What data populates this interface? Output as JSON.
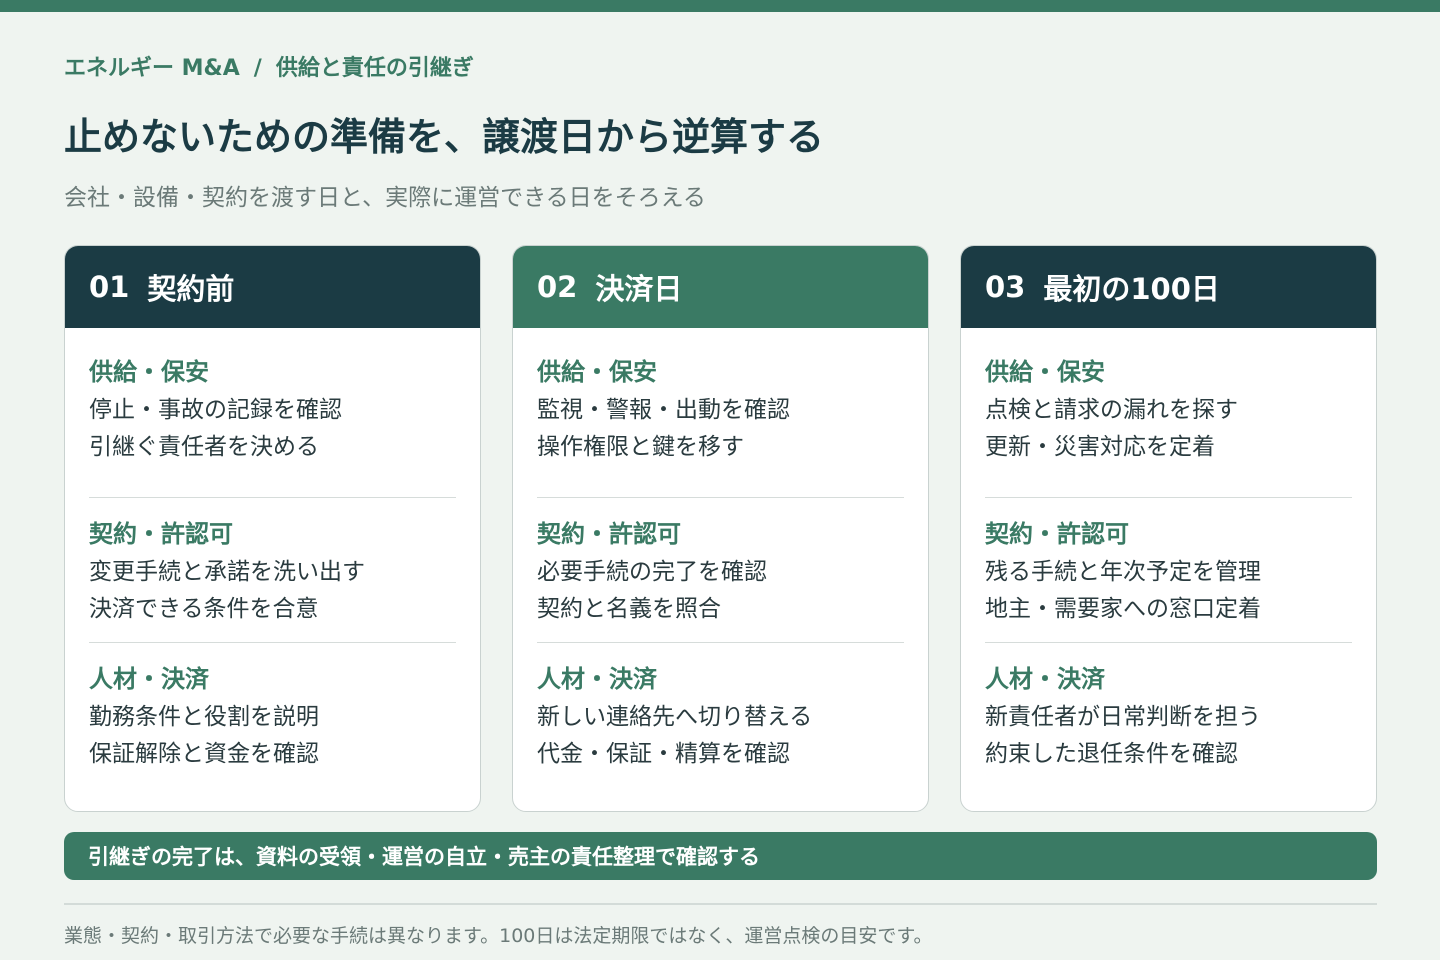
{
  "breadcrumb": {
    "category": "エネルギー M&A",
    "separator": "/",
    "topic": "供給と責任の引継ぎ"
  },
  "title": "止めないための準備を、譲渡日から逆算する",
  "subtitle": "会社・設備・契約を渡す日と、実際に運営できる日をそろえる",
  "colors": {
    "dark": "#1b3b44",
    "green": "#3a7a64",
    "background": "#eff4f0"
  },
  "cards": [
    {
      "number": "01",
      "label": "契約前",
      "sections": [
        {
          "title": "供給・保安",
          "items": [
            "停止・事故の記録を確認",
            "引継ぐ責任者を決める"
          ]
        },
        {
          "title": "契約・許認可",
          "items": [
            "変更手続と承諾を洗い出す",
            "決済できる条件を合意"
          ]
        },
        {
          "title": "人材・決済",
          "items": [
            "勤務条件と役割を説明",
            "保証解除と資金を確認"
          ]
        }
      ]
    },
    {
      "number": "02",
      "label": "決済日",
      "sections": [
        {
          "title": "供給・保安",
          "items": [
            "監視・警報・出動を確認",
            "操作権限と鍵を移す"
          ]
        },
        {
          "title": "契約・許認可",
          "items": [
            "必要手続の完了を確認",
            "契約と名義を照合"
          ]
        },
        {
          "title": "人材・決済",
          "items": [
            "新しい連絡先へ切り替える",
            "代金・保証・精算を確認"
          ]
        }
      ]
    },
    {
      "number": "03",
      "label": "最初の100日",
      "sections": [
        {
          "title": "供給・保安",
          "items": [
            "点検と請求の漏れを探す",
            "更新・災害対応を定着"
          ]
        },
        {
          "title": "契約・許認可",
          "items": [
            "残る手続と年次予定を管理",
            "地主・需要家への窓口定着"
          ]
        },
        {
          "title": "人材・決済",
          "items": [
            "新責任者が日常判断を担う",
            "約束した退任条件を確認"
          ]
        }
      ]
    }
  ],
  "banner": "引継ぎの完了は、資料の受領・運営の自立・売主の責任整理で確認する",
  "footnote": "業態・契約・取引方法で必要な手続は異なります。100日は法定期限ではなく、運営点検の目安です。"
}
